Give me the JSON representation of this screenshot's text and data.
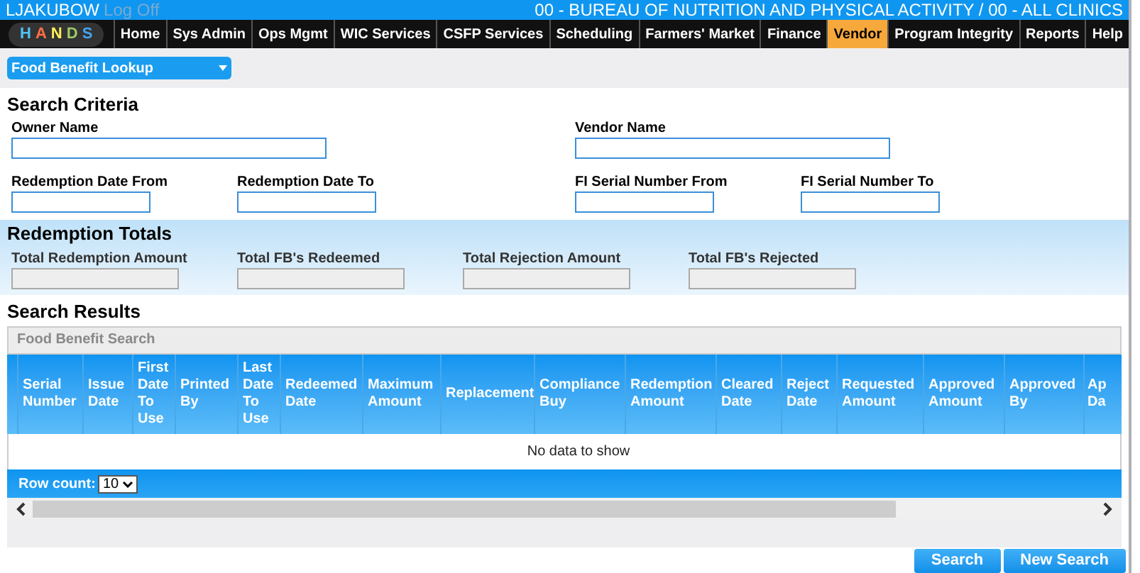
{
  "header": {
    "user": "LJAKUBOW",
    "logoff": "Log Off",
    "org": "00 - BUREAU OF NUTRITION AND PHYSICAL ACTIVITY / 00 - ALL CLINICS"
  },
  "logo": {
    "letters": [
      {
        "text": "H",
        "color": "#4fc3f7"
      },
      {
        "text": "A",
        "color": "#ff7043"
      },
      {
        "text": "N",
        "color": "#ffee58"
      },
      {
        "text": "D",
        "color": "#9ccc65"
      },
      {
        "text": "S",
        "color": "#42a5f5"
      }
    ]
  },
  "nav": [
    {
      "label": "Home",
      "selected": false
    },
    {
      "label": "Sys Admin",
      "selected": false
    },
    {
      "label": "Ops Mgmt",
      "selected": false
    },
    {
      "label": "WIC Services",
      "selected": false
    },
    {
      "label": "CSFP Services",
      "selected": false
    },
    {
      "label": "Scheduling",
      "selected": false
    },
    {
      "label": "Farmers' Market",
      "selected": false
    },
    {
      "label": "Finance",
      "selected": false
    },
    {
      "label": "Vendor",
      "selected": true
    },
    {
      "label": "Program Integrity",
      "selected": false
    },
    {
      "label": "Reports",
      "selected": false
    },
    {
      "label": "Help",
      "selected": false
    }
  ],
  "page_menu": {
    "label": "Food Benefit Lookup"
  },
  "search_criteria": {
    "title": "Search Criteria",
    "fields": [
      {
        "label": "Owner Name",
        "kind": "text"
      },
      {
        "label": "Vendor Name",
        "kind": "text"
      },
      {
        "label": "Redemption Date From",
        "kind": "range"
      },
      {
        "label": "Redemption Date To",
        "kind": "range"
      },
      {
        "label": "FI Serial Number From",
        "kind": "range"
      },
      {
        "label": "FI Serial Number To",
        "kind": "range"
      }
    ]
  },
  "redemption_totals": {
    "title": "Redemption Totals",
    "fields": [
      {
        "label": "Total Redemption Amount",
        "disabled": true
      },
      {
        "label": "Total FB's Redeemed",
        "disabled": true
      },
      {
        "label": "Total Rejection Amount",
        "disabled": true
      },
      {
        "label": "Total FB's Rejected",
        "disabled": true
      }
    ]
  },
  "search_results": {
    "title": "Search Results",
    "grid_title": "Food Benefit Search",
    "columns": [
      "Serial Number",
      "Issue Date",
      "First Date To Use",
      "Printed By",
      "Last Date To Use",
      "Redeemed Date",
      "Maximum Amount",
      "Replacement",
      "Compliance Buy",
      "Redemption Amount",
      "Cleared Date",
      "Reject Date",
      "Requested Amount",
      "Approved Amount",
      "Approved By",
      "Ap Da"
    ],
    "empty_message": "No data to show",
    "row_count_label": "Row count:",
    "row_count": "10"
  },
  "buttons": [
    "Search",
    "New Search"
  ]
}
